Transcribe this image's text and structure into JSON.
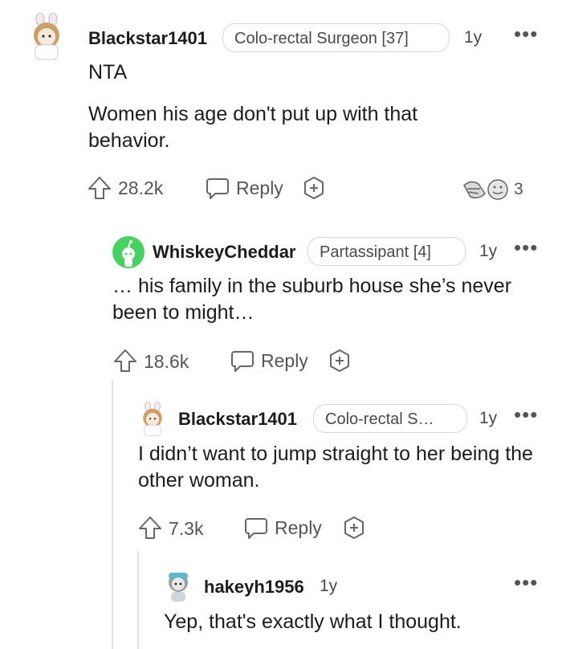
{
  "comments": [
    {
      "username": "Blackstar1401",
      "flair": "Colo-rectal Surgeon [37]",
      "age": "1y",
      "more": "•••",
      "paragraphs": [
        "NTA",
        "Women his age don't put up with that behavior."
      ],
      "upvotes": "28.2k",
      "reply_label": "Reply",
      "awards_count": "3"
    },
    {
      "username": "WhiskeyCheddar",
      "flair": "Partassipant [4]",
      "age": "1y",
      "more": "•••",
      "body": "… his family in the suburb house she’s never been to might…",
      "upvotes": "18.6k",
      "reply_label": "Reply"
    },
    {
      "username": "Blackstar1401",
      "flair": "Colo-rectal S…",
      "age": "1y",
      "more": "•••",
      "body": "I didn’t want to jump straight to her being the other woman.",
      "upvotes": "7.3k",
      "reply_label": "Reply"
    },
    {
      "username": "hakeyh1956",
      "age": "1y",
      "more": "•••",
      "body": "Yep, that's exactly what I thought."
    }
  ]
}
